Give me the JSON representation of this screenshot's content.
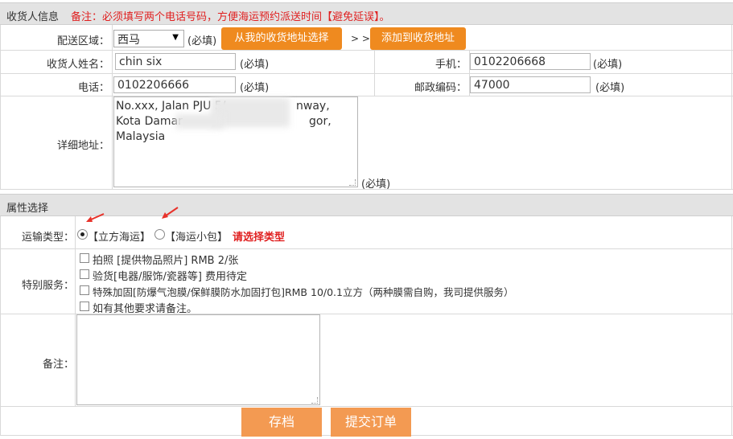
{
  "consignee_section": {
    "title": "收货人信息",
    "note": "备注：必须填写两个电话号码，方便海运预约派送时间【避免延误】。"
  },
  "delivery_area": {
    "label": "配送区域：",
    "selected": "西马",
    "required": "(必填)",
    "choose_button": "从我的收货地址选择",
    "separator": "> >",
    "add_button": "添加到收货地址"
  },
  "name": {
    "label": "收货人姓名：",
    "value": "chin six",
    "required": "(必填)"
  },
  "mobile": {
    "label": "手机：",
    "value": "0102206668",
    "required": "(必填)"
  },
  "phone": {
    "label": "电话：",
    "value": "0102206666",
    "required": "(必填)"
  },
  "postcode": {
    "label": "邮政编码：",
    "value": "47000",
    "required": "(必填)"
  },
  "address": {
    "label": "详细地址：",
    "line1_a": "No.xxx, Jalan PJU 5/",
    "line1_b": "nway,",
    "line2_a": "Kota Damar",
    "line2_b": "gor,",
    "line3": "Malaysia",
    "required": "(必填)"
  },
  "attributes_section": {
    "title": "属性选择"
  },
  "shipping_type": {
    "label": "运输类型：",
    "option1": "【立方海运】",
    "option2": "【海运小包】",
    "warning": "请选择类型"
  },
  "special_services": {
    "label": "特别服务：",
    "items": [
      "拍照 [提供物品照片] RMB 2/张",
      "验货[电器/服饰/瓷器等] 费用待定",
      "特殊加固[防爆气泡膜/保鲜膜防水加固打包]RMB 10/0.1立方（两种膜需自购，我司提供服务）",
      "如有其他要求请备注。"
    ]
  },
  "remarks": {
    "label": "备注："
  },
  "buttons": {
    "save": "存档",
    "submit": "提交订单"
  },
  "colors": {
    "orange": "#ef8a1f",
    "bottom_button": "#f39a52",
    "warning_red": "#e02020",
    "section_bg": "#e3e3e3"
  }
}
